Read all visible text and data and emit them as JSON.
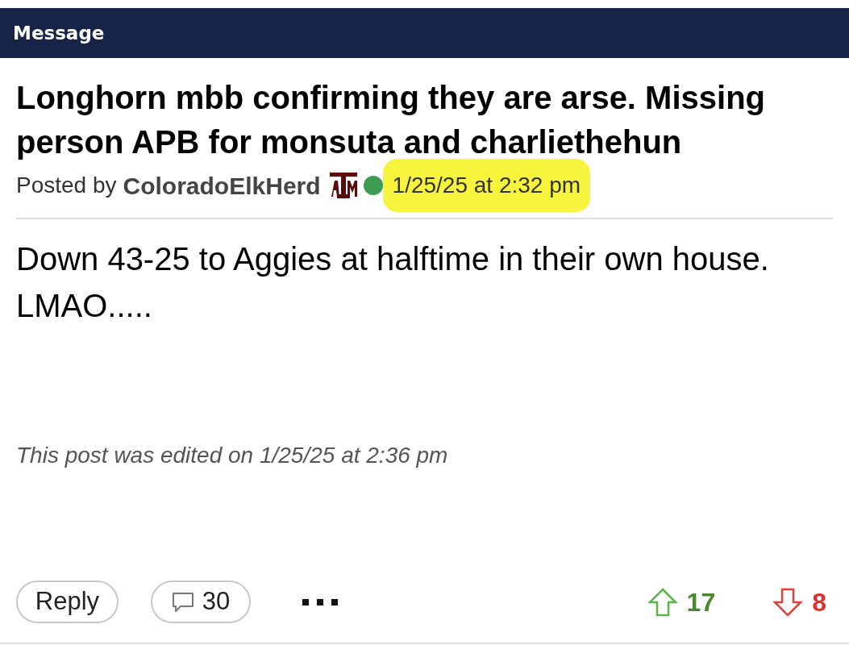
{
  "header": {
    "title": "Message"
  },
  "post": {
    "title": "Longhorn mbb confirming they are arse. Missing person APB for monsuta and charliethehun",
    "posted_by_label": "Posted by",
    "author": "ColoradoElkHerd",
    "online": true,
    "timestamp": "1/25/25 at 2:32 pm",
    "timestamp_highlighted": true,
    "body": "Down 43-25 to Aggies at halftime in their own house. LMAO.....",
    "edited_note": "This post was edited on 1/25/25 at 2:36 pm"
  },
  "actions": {
    "reply": "Reply",
    "comments": "30"
  },
  "votes": {
    "up": "17",
    "down": "8"
  }
}
